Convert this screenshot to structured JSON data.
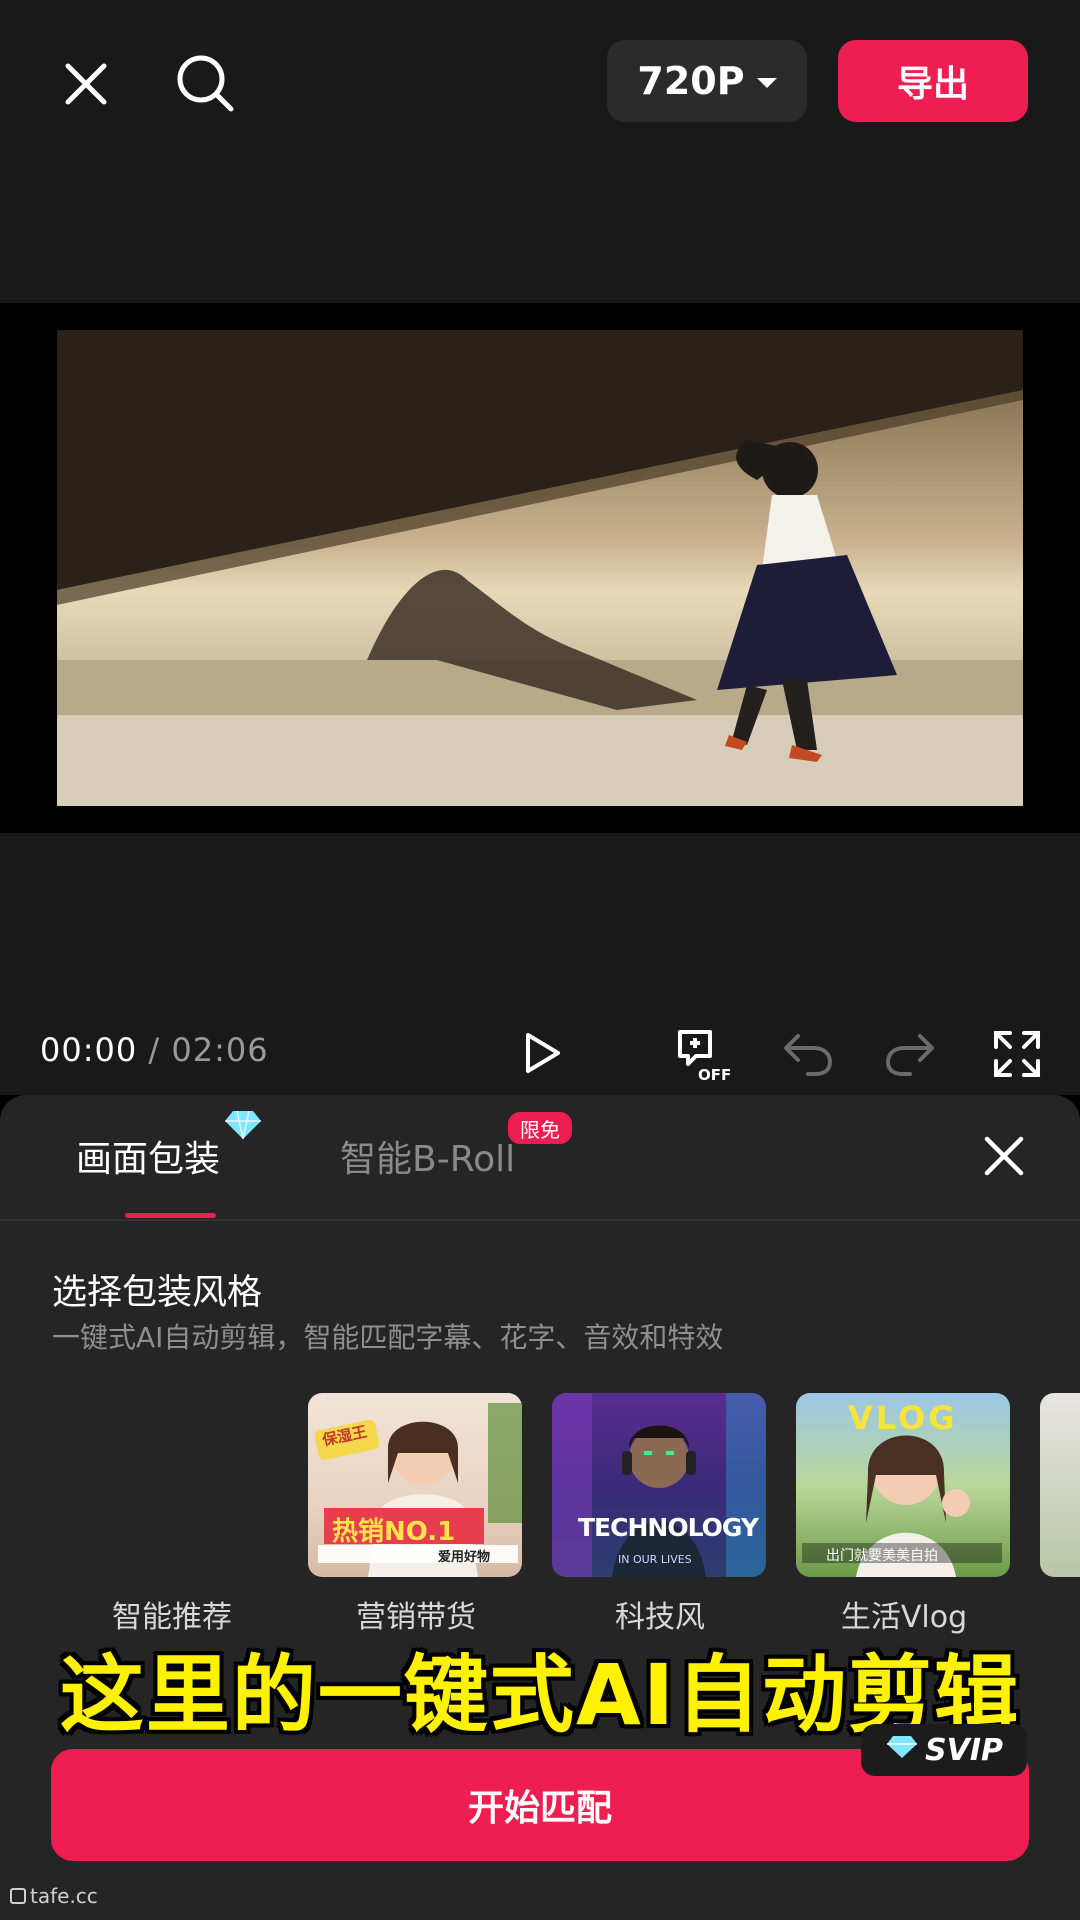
{
  "header": {
    "resolution": "720P",
    "export_label": "导出"
  },
  "player": {
    "current_time": "00:00",
    "separator": "/",
    "total_time": "02:06",
    "off_label": "OFF"
  },
  "panel": {
    "tabs": [
      {
        "label": "画面包装",
        "active": true,
        "badge": "diamond-icon"
      },
      {
        "label": "智能B-Roll",
        "active": false,
        "badge": "限免"
      }
    ],
    "section_title": "选择包装风格",
    "section_subtitle": "一键式AI自动剪辑，智能匹配字幕、花字、音效和特效",
    "styles": [
      {
        "label": "智能推荐",
        "selected": true
      },
      {
        "label": "营销带货",
        "selected": false,
        "thumb_text": "热销NO.1",
        "thumb_sub": "爱用好物",
        "thumb_tag": "保湿王"
      },
      {
        "label": "科技风",
        "selected": false,
        "thumb_text": "TECHNOLOGY",
        "thumb_sub": "IN OUR LIVES"
      },
      {
        "label": "生活Vlog",
        "selected": false,
        "thumb_text": "VLOG",
        "thumb_sub": "出门就要美美自拍"
      }
    ],
    "start_button": "开始匹配",
    "svip_label": "SVIP"
  },
  "overlay": {
    "caption": "这里的一键式AI自动剪辑",
    "watermark": "tafe.cc"
  },
  "colors": {
    "accent": "#ee1d52",
    "caption": "#fff200",
    "panel_bg": "#252525",
    "topbar_bg": "#191919"
  }
}
